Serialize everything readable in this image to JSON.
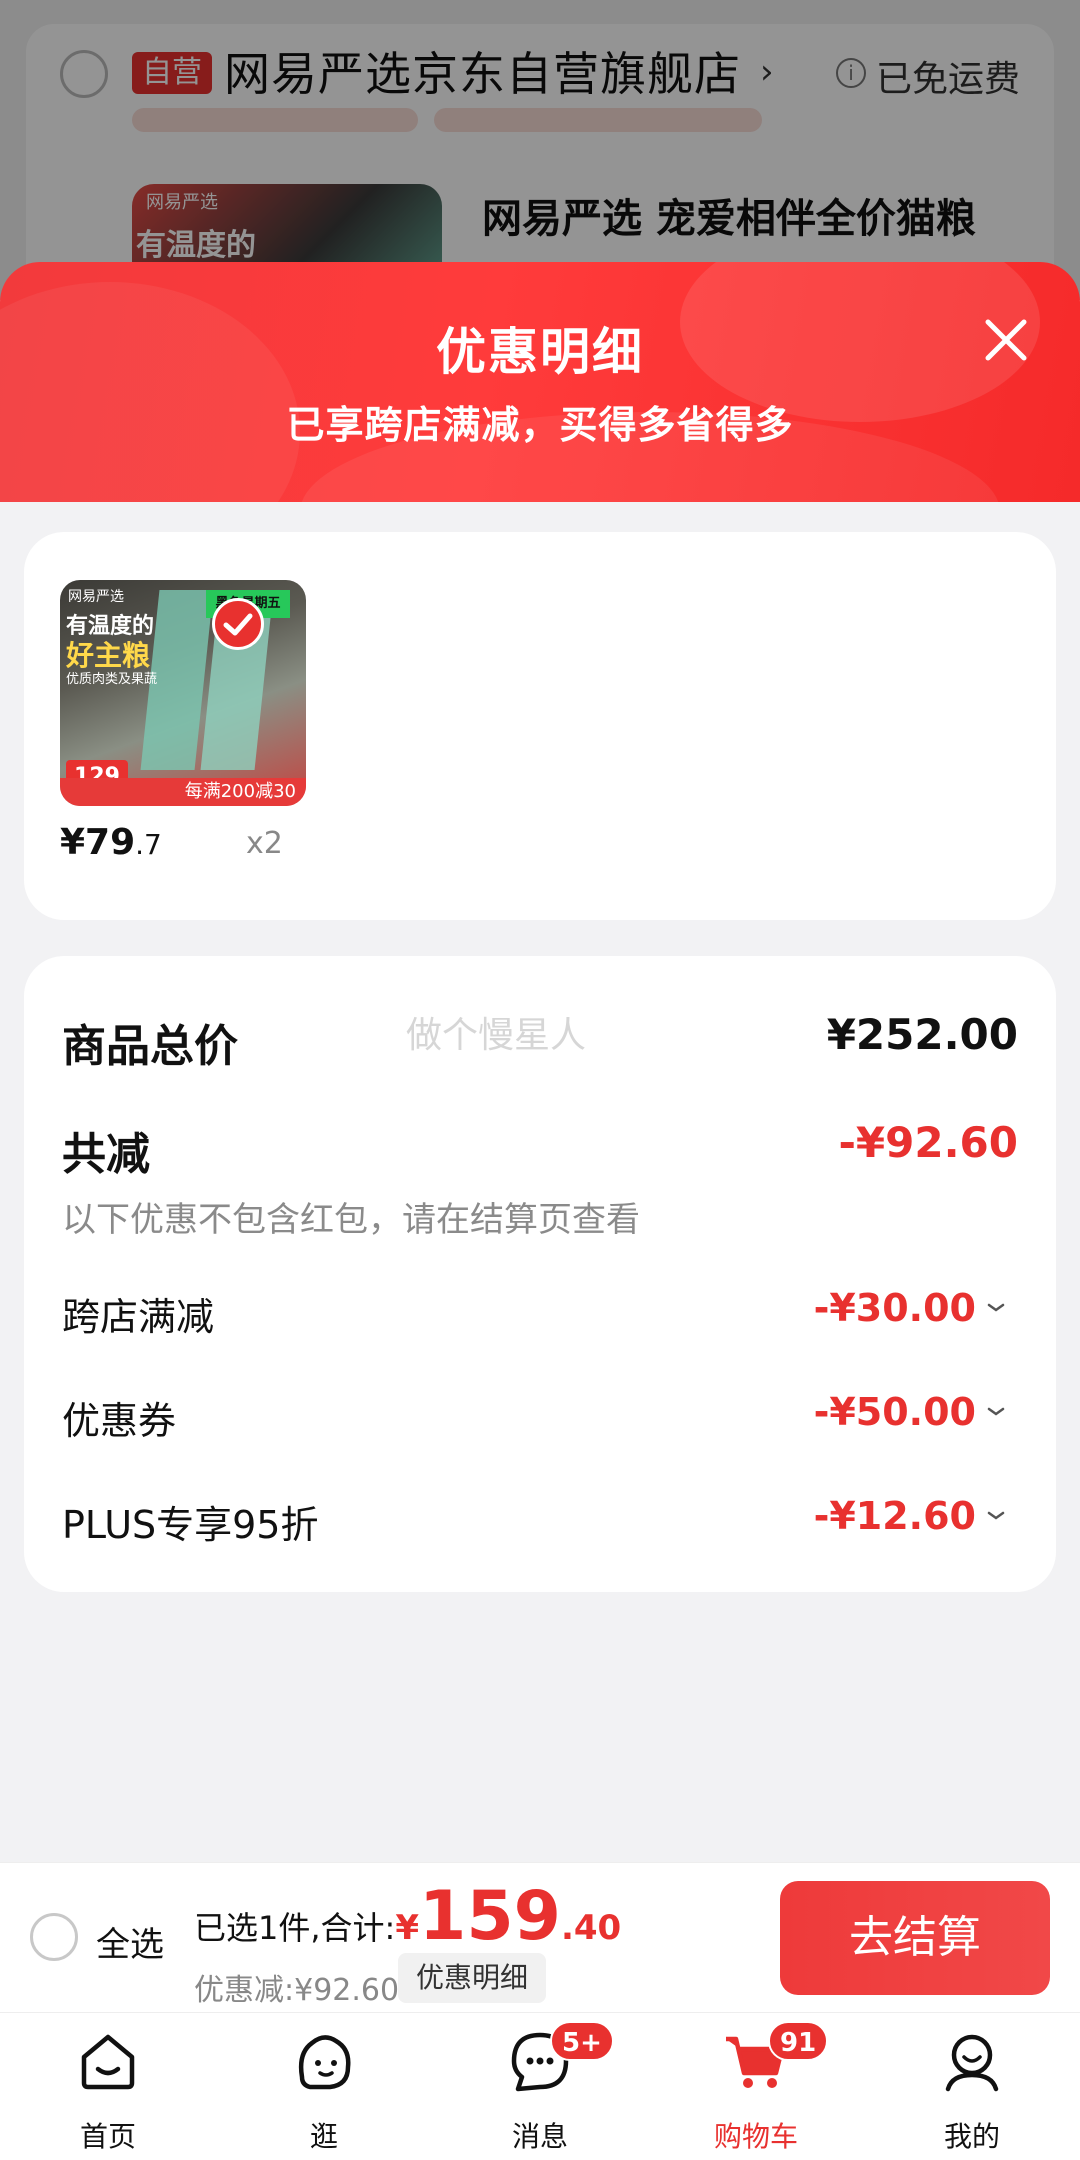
{
  "background": {
    "store_badge": "自营",
    "store_name": "网易严选京东自营旗舰店",
    "shipping": "已免运费",
    "thumb_brand": "网易严选",
    "thumb_text": "有温度的",
    "product_name": "网易严选 宠爱相伴全价猫粮"
  },
  "sheet": {
    "title": "优惠明细",
    "subtitle": "已享跨店满减，买得多省得多"
  },
  "item": {
    "image": {
      "brand": "网易严选",
      "headline1": "有温度的",
      "headline2": "好主粮",
      "desc": "优质肉类及果蔬",
      "tag": "黑色星期五",
      "price_tag": "129",
      "promo": "每满200减30"
    },
    "price_int": "¥79",
    "price_dec": ".7",
    "qty": "x2"
  },
  "totals": {
    "total_label": "商品总价",
    "watermark": "做个慢星人",
    "total_value": "¥252.00",
    "reduce_label": "共减",
    "reduce_value": "-¥92.60",
    "note": "以下优惠不包含红包，请在结算页查看",
    "discounts": [
      {
        "label": "跨店满减",
        "value": "-¥30.00"
      },
      {
        "label": "优惠券",
        "value": "-¥50.00"
      },
      {
        "label": "PLUS专享95折",
        "value": "-¥12.60"
      }
    ]
  },
  "checkout": {
    "select_all": "全选",
    "summary_label": "已选1件,合计:",
    "currency": "¥",
    "total_int": "159",
    "total_dec": ".40",
    "savings": "优惠减:¥92.60",
    "detail_button": "优惠明细",
    "checkout_button": "去结算"
  },
  "nav": {
    "items": [
      {
        "label": "首页",
        "icon": "home-icon"
      },
      {
        "label": "逛",
        "icon": "discover-icon"
      },
      {
        "label": "消息",
        "icon": "message-icon",
        "badge": "5+"
      },
      {
        "label": "购物车",
        "icon": "cart-icon",
        "badge": "91",
        "active": true
      },
      {
        "label": "我的",
        "icon": "profile-icon"
      }
    ]
  },
  "colors": {
    "accent": "#e8312f",
    "header_gradient_start": "#f23a3c",
    "header_gradient_end": "#f52a2a"
  }
}
